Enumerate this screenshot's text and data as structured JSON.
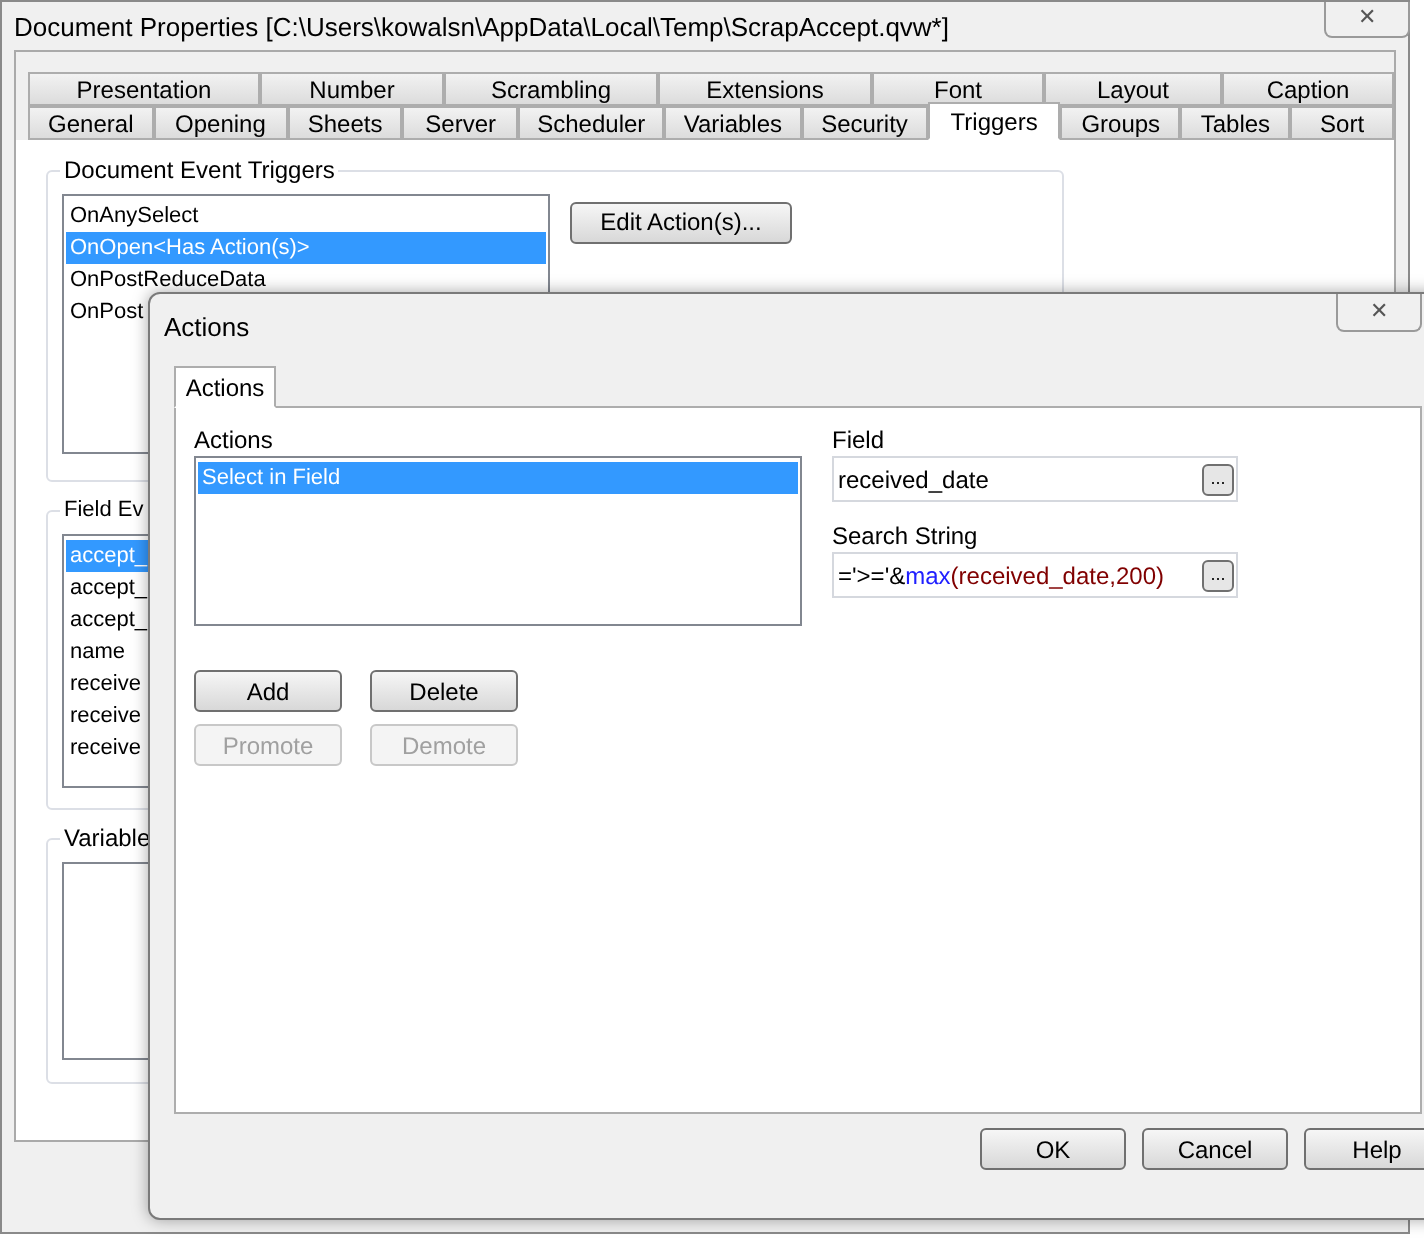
{
  "window": {
    "title": "Document Properties [C:\\Users\\kowalsn\\AppData\\Local\\Temp\\ScrapAccept.qvw*]",
    "close": "✕"
  },
  "tab_rows": [
    [
      {
        "label": "Presentation",
        "selected": false
      },
      {
        "label": "Number",
        "selected": false
      },
      {
        "label": "Scrambling",
        "selected": false
      },
      {
        "label": "Extensions",
        "selected": false
      },
      {
        "label": "Font",
        "selected": false
      },
      {
        "label": "Layout",
        "selected": false
      },
      {
        "label": "Caption",
        "selected": false
      }
    ],
    [
      {
        "label": "General",
        "selected": false
      },
      {
        "label": "Opening",
        "selected": false
      },
      {
        "label": "Sheets",
        "selected": false
      },
      {
        "label": "Server",
        "selected": false
      },
      {
        "label": "Scheduler",
        "selected": false
      },
      {
        "label": "Variables",
        "selected": false
      },
      {
        "label": "Security",
        "selected": false
      },
      {
        "label": "Triggers",
        "selected": true
      },
      {
        "label": "Groups",
        "selected": false
      },
      {
        "label": "Tables",
        "selected": false
      },
      {
        "label": "Sort",
        "selected": false
      }
    ]
  ],
  "document_event_triggers": {
    "title": "Document Event Triggers",
    "items": [
      {
        "label": "OnAnySelect",
        "selected": false
      },
      {
        "label": "OnOpen<Has Action(s)>",
        "selected": true
      },
      {
        "label": "OnPostReduceData",
        "selected": false
      },
      {
        "label": "OnPost",
        "selected": false
      }
    ],
    "button": "Edit Action(s)..."
  },
  "field_event_triggers": {
    "title": "Field Ev",
    "items": [
      {
        "label": "accept_",
        "selected": true
      },
      {
        "label": "accept_",
        "selected": false
      },
      {
        "label": "accept_",
        "selected": false
      },
      {
        "label": "name",
        "selected": false
      },
      {
        "label": "receive",
        "selected": false
      },
      {
        "label": "receive",
        "selected": false
      },
      {
        "label": "receive",
        "selected": false
      }
    ]
  },
  "variable_event_triggers": {
    "title": "Variable"
  },
  "dialog": {
    "title": "Actions",
    "close": "✕",
    "tab": {
      "label": "Actions",
      "selected": true
    },
    "actions_label": "Actions",
    "actions": [
      {
        "label": "Select in Field",
        "selected": true
      }
    ],
    "buttons": [
      {
        "label": "Add",
        "disabled": false
      },
      {
        "label": "Delete",
        "disabled": false
      },
      {
        "label": "Promote",
        "disabled": true
      },
      {
        "label": "Demote",
        "disabled": true
      }
    ],
    "field_label": "Field",
    "field_value": "received_date",
    "browse": "...",
    "search_label": "Search String",
    "search_value": [
      {
        "text": "='>='&",
        "kind": "plain"
      },
      {
        "text": "max",
        "kind": "function"
      },
      {
        "text": "(received_date,200)",
        "kind": "argument"
      }
    ],
    "footer_buttons": [
      "OK",
      "Cancel",
      "Help"
    ]
  }
}
